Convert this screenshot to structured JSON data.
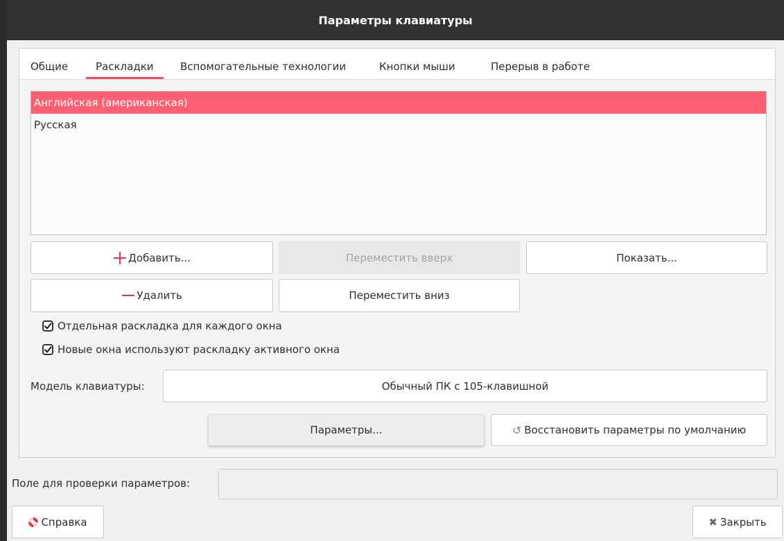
{
  "window": {
    "title": "Параметры клавиатуры"
  },
  "tabs": [
    {
      "label": "Общие"
    },
    {
      "label": "Раскладки"
    },
    {
      "label": "Вспомогательные технологии"
    },
    {
      "label": "Кнопки мыши"
    },
    {
      "label": "Перерыв в работе"
    }
  ],
  "active_tab": "Раскладки",
  "layouts": {
    "items": [
      {
        "label": "Английская (американская)",
        "selected": true
      },
      {
        "label": "Русская",
        "selected": false
      }
    ]
  },
  "buttons": {
    "add": "Добавить...",
    "move_up": "Переместить вверх",
    "show": "Показать...",
    "remove": "Удалить",
    "move_down": "Переместить вниз",
    "options": "Параметры...",
    "restore_defaults": "Восстановить параметры по умолчанию",
    "help": "Справка",
    "close": "Закрыть"
  },
  "checkboxes": {
    "separate_layout": {
      "label": "Отдельная раскладка для каждого окна",
      "checked": true
    },
    "new_windows_active": {
      "label": "Новые окна используют раскладку активного окна",
      "checked": true
    }
  },
  "keyboard_model": {
    "label": "Модель клавиатуры:",
    "value": "Обычный ПК с 105-клавишной"
  },
  "test_field": {
    "label": "Поле для проверки параметров:",
    "value": ""
  },
  "colors": {
    "accent": "#e84a5f",
    "selection": "#ff5f73",
    "titlebar": "#323232"
  }
}
